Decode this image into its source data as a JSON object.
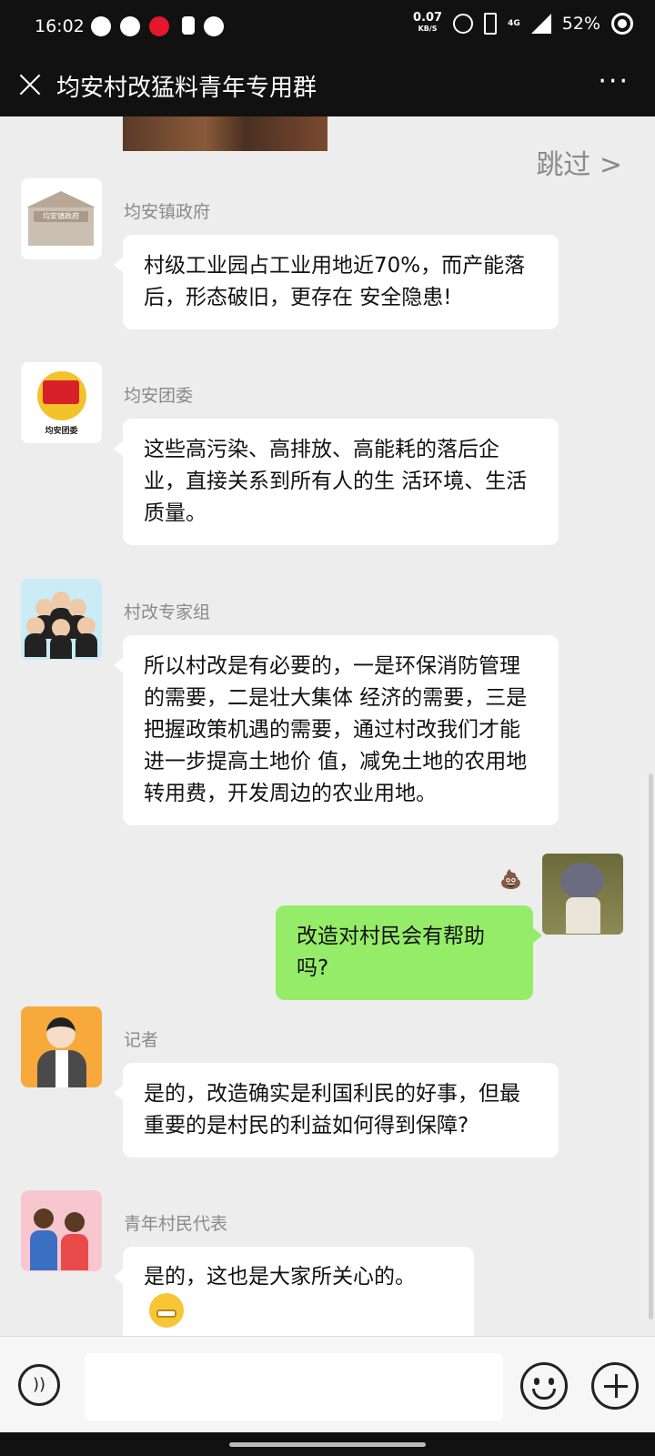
{
  "status_bar": {
    "time": "16:02",
    "net_speed": "0.07",
    "net_unit": "KB/S",
    "network": "4G",
    "battery": "52%",
    "icons": [
      "message-icon",
      "notification-icon",
      "weibo-icon",
      "download-icon",
      "sync-icon",
      "alarm-icon",
      "vibrate-icon",
      "signal-icon",
      "battery-icon"
    ]
  },
  "header": {
    "title": "均安村改猛料青年专用群",
    "close_icon": "close-icon",
    "more_icon": "more-icon"
  },
  "skip_label": "跳过 >",
  "messages": [
    {
      "sender": "均安镇政府",
      "avatar": "government-building-icon",
      "avatar_text": "均安镇政府",
      "text": "村级工业园占工业用地近70%，而产能落后，形态破旧，更存在 安全隐患!"
    },
    {
      "sender": "均安团委",
      "avatar": "youth-league-badge-icon",
      "avatar_text": "均安团委",
      "text": "这些高污染、高排放、高能耗的落后企业，直接关系到所有人的生 活环境、生活质量。"
    },
    {
      "sender": "村改专家组",
      "avatar": "expert-group-icon",
      "text": "所以村改是有必要的，一是环保消防管理的需要，二是壮大集体 经济的需要，三是把握政策机遇的需要，通过村改我们才能进一步提高土地价 值，减免土地的农用地转用费，开发周边的农业用地。"
    },
    {
      "sender": "me",
      "avatar": "cartoon-cat-avatar",
      "badge": "💩",
      "text": "改造对村民会有帮助吗?"
    },
    {
      "sender": "记者",
      "avatar": "reporter-icon",
      "text": "是的，改造确实是利国利民的好事，但最重要的是村民的利益如何得到保障?"
    },
    {
      "sender": "青年村民代表",
      "avatar": "villagers-icon",
      "text": "是的，这也是大家所关心的。",
      "emoji": "grinning-emoji"
    }
  ],
  "input_bar": {
    "voice_icon": "voice-icon",
    "placeholder": "",
    "emoji_icon": "emoji-icon",
    "plus_icon": "plus-icon"
  }
}
